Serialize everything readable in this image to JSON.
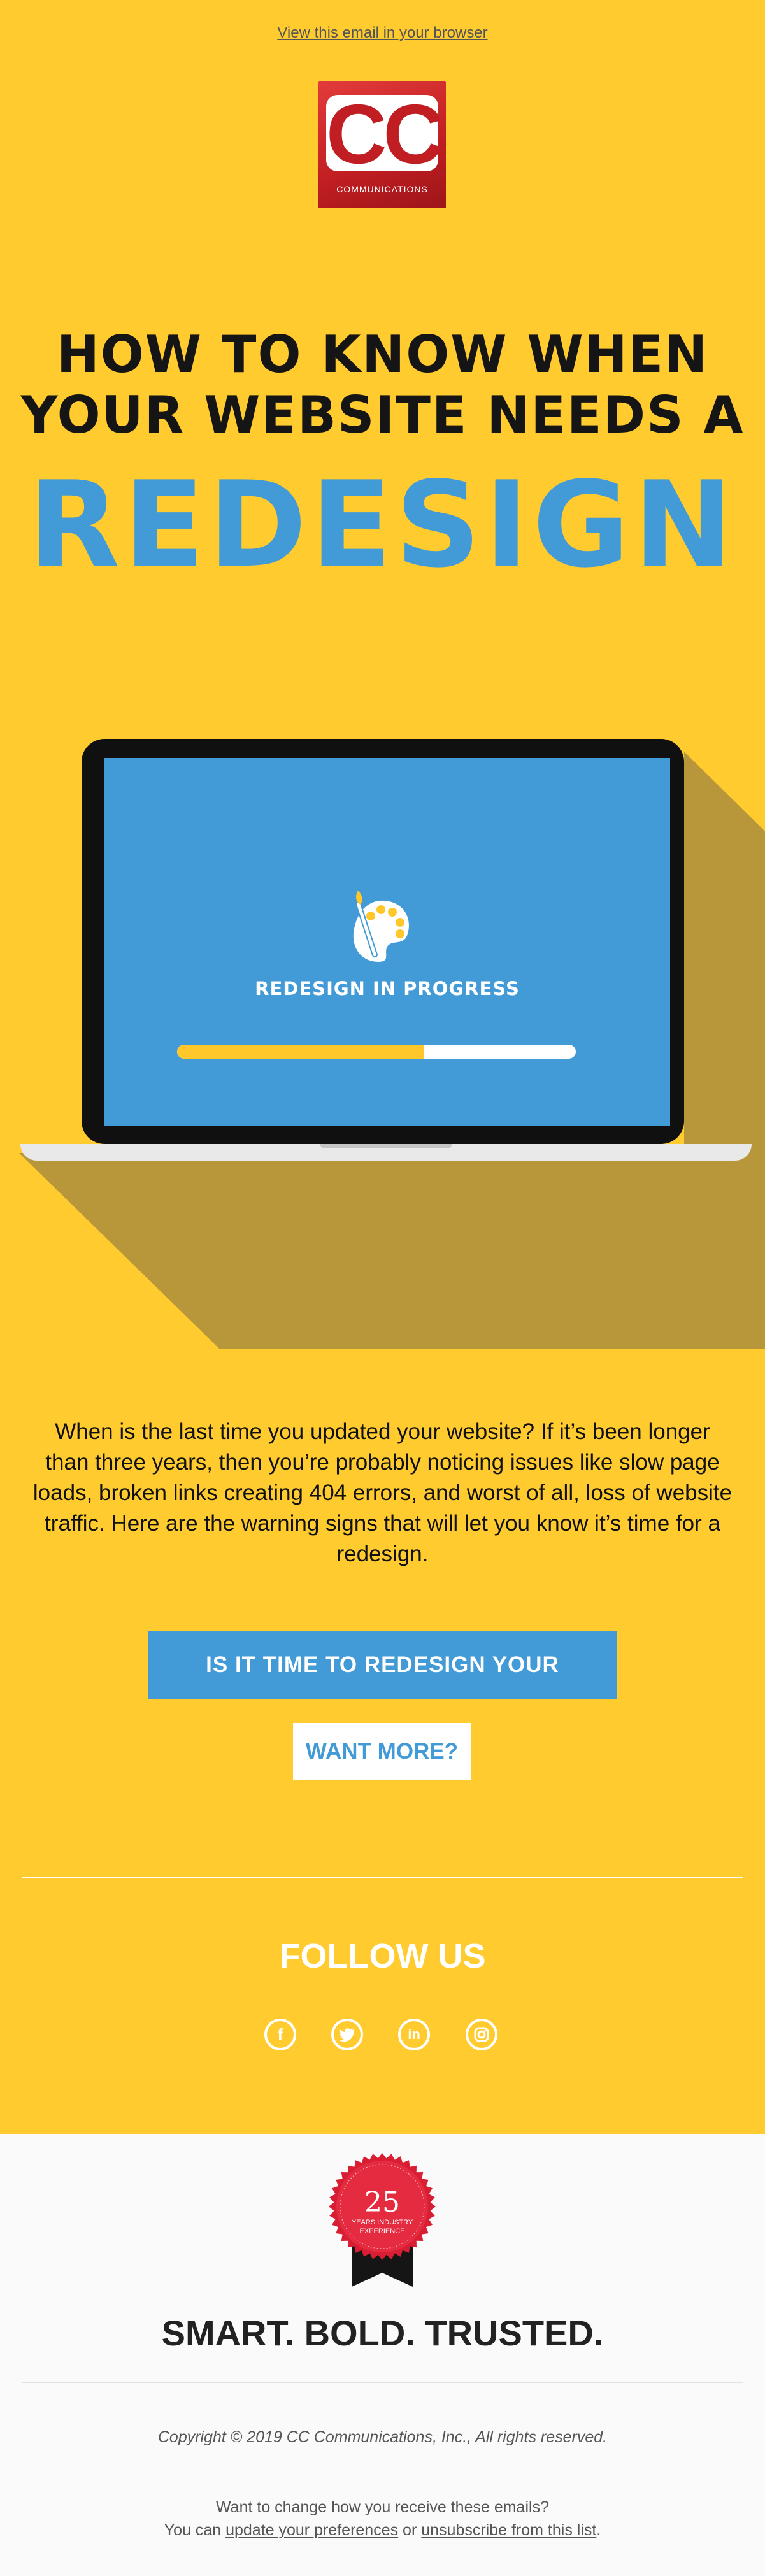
{
  "header": {
    "view_in_browser": "View this email in your browser"
  },
  "logo": {
    "letters": "CC",
    "subtitle": "COMMUNICATIONS"
  },
  "hero": {
    "line1": "HOW TO KNOW WHEN",
    "line2": "YOUR WEBSITE NEEDS A",
    "line3": "REDESIGN",
    "screen_label": "REDESIGN IN PROGRESS",
    "progress": 0.62
  },
  "intro": "When is the last time you updated your website? If it’s been longer than three years, then you’re probably noticing issues like slow page loads, broken links creating 404 errors, and worst of all, loss of website traffic. Here are the warning signs that will let you know it’s time for a redesign.",
  "buttons": {
    "primary": "IS IT TIME TO REDESIGN YOUR WEBSITE?",
    "secondary": "WANT MORE?"
  },
  "follow": {
    "title": "FOLLOW US",
    "icons": [
      "facebook-icon",
      "twitter-icon",
      "linkedin-icon",
      "instagram-icon"
    ]
  },
  "footer": {
    "seal_number": "25",
    "seal_line1": "YEARS INDUSTRY",
    "seal_line2": "EXPERIENCE",
    "tagline": "SMART. BOLD. TRUSTED.",
    "copyright": "Copyright © 2019 CC Communications, Inc., All rights reserved.",
    "change_text": "Want to change how you receive these emails?",
    "prefix": "You can ",
    "update_link": "update your preferences",
    "or": " or ",
    "unsubscribe_link": "unsubscribe from this list",
    "suffix": "."
  },
  "colors": {
    "yellow": "#ffcb2f",
    "blue": "#429ad6",
    "red": "#c01e22"
  }
}
